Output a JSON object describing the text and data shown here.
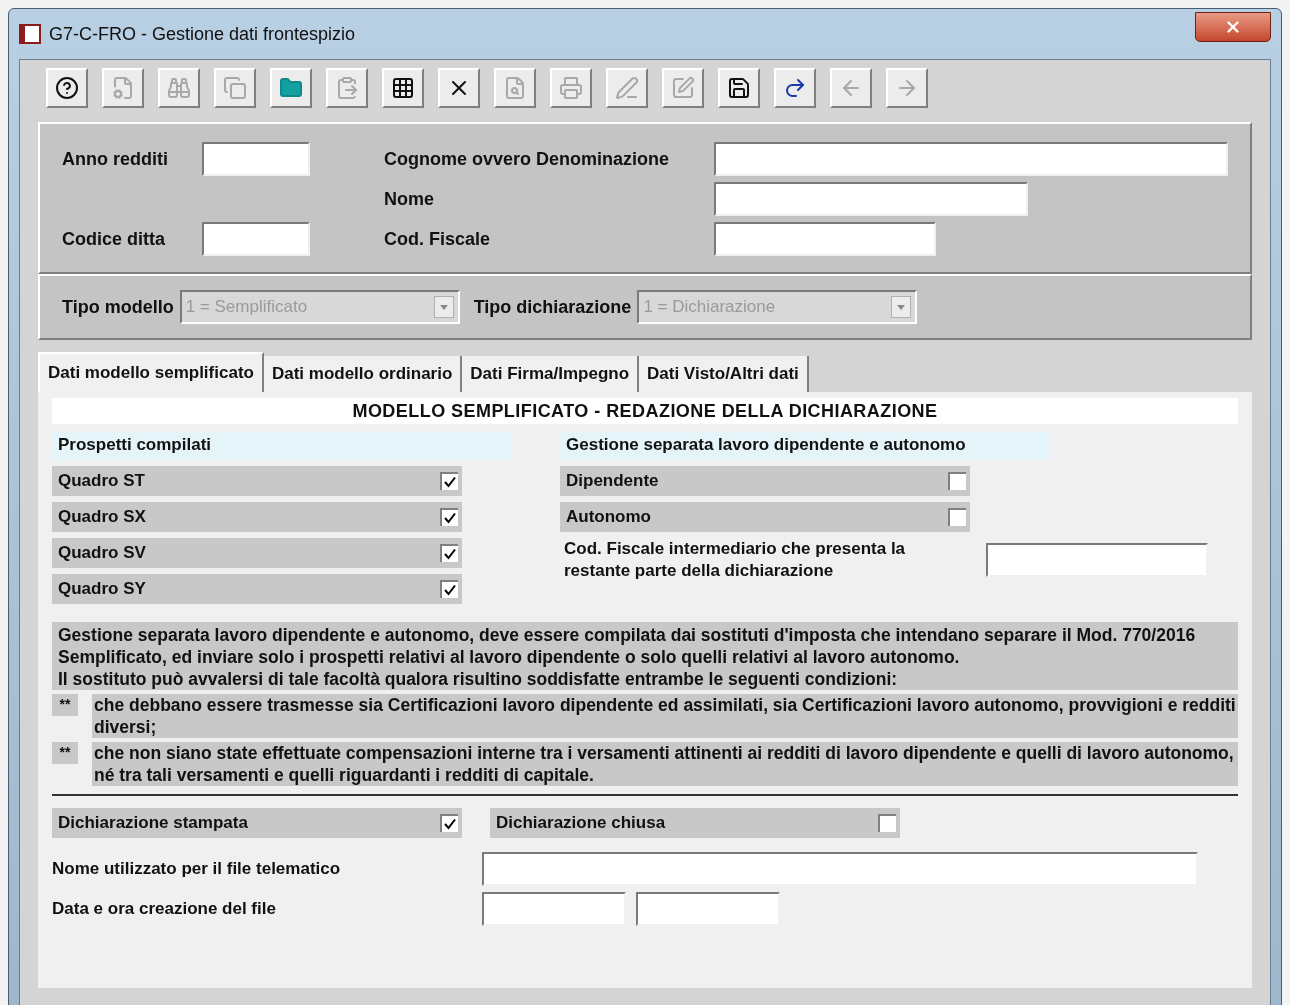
{
  "window": {
    "title": "G7-C-FRO - Gestione dati frontespizio"
  },
  "toolbar": [
    {
      "kind": "help",
      "disabled": false
    },
    {
      "kind": "properties",
      "disabled": true
    },
    {
      "kind": "search",
      "disabled": true
    },
    {
      "kind": "copy",
      "disabled": true
    },
    {
      "kind": "folder",
      "disabled": false
    },
    {
      "kind": "paste",
      "disabled": true
    },
    {
      "kind": "grid",
      "disabled": false
    },
    {
      "kind": "delete",
      "disabled": false
    },
    {
      "kind": "preview",
      "disabled": true
    },
    {
      "kind": "print",
      "disabled": true
    },
    {
      "kind": "edit",
      "disabled": true
    },
    {
      "kind": "form",
      "disabled": true
    },
    {
      "kind": "save",
      "disabled": false
    },
    {
      "kind": "redo",
      "disabled": false
    },
    {
      "kind": "back",
      "disabled": true
    },
    {
      "kind": "forward",
      "disabled": true
    }
  ],
  "header": {
    "anno_redditi": "Anno redditi",
    "codice_ditta": "Codice ditta",
    "cognome": "Cognome ovvero Denominazione",
    "nome": "Nome",
    "cod_fiscale": "Cod. Fiscale"
  },
  "selectors": [
    {
      "label": "Tipo modello",
      "value": "1 = Semplificato",
      "disabled": true
    },
    {
      "label": "Tipo dichiarazione",
      "value": "1 = Dichiarazione",
      "disabled": true
    }
  ],
  "tabs": [
    {
      "label": "Dati modello semplificato",
      "selected": true
    },
    {
      "label": "Dati modello ordinario",
      "selected": false
    },
    {
      "label": "Dati Firma/Impegno",
      "selected": false
    },
    {
      "label": "Dati Visto/Altri dati",
      "selected": false
    }
  ],
  "panel_title": "MODELLO SEMPLIFICATO - REDAZIONE DELLA DICHIARAZIONE",
  "prospetti": {
    "heading": "Prospetti compilati",
    "items": [
      {
        "label": "Quadro ST",
        "checked": true
      },
      {
        "label": "Quadro SX",
        "checked": true
      },
      {
        "label": "Quadro SV",
        "checked": true
      },
      {
        "label": "Quadro SY",
        "checked": true
      }
    ]
  },
  "gestione": {
    "heading": "Gestione separata lavoro dipendente e autonomo",
    "items": [
      {
        "label": "Dipendente",
        "checked": false
      },
      {
        "label": "Autonomo",
        "checked": false
      }
    ],
    "intermediary_label": "Cod. Fiscale intermediario che presenta la restante parte della dichiarazione"
  },
  "notes": {
    "paragraph": "Gestione separata lavoro dipendente e autonomo, deve essere compilata dai sostituti d'imposta che intendano separare il Mod. 770/2016 Semplificato, ed inviare solo i prospetti relativi al lavoro dipendente o solo quelli relativi al lavoro autonomo.",
    "condition": "Il sostituto può avvalersi di tale facoltà qualora risultino soddisfatte entrambe le seguenti condizioni:",
    "bullets": [
      {
        "marker": "**",
        "text": "che debbano essere trasmesse sia Certificazioni lavoro dipendente ed assimilati, sia Certificazioni lavoro autonomo, provvigioni e redditi diversi;"
      },
      {
        "marker": "**",
        "text": "che non siano state effettuate compensazioni interne tra i versamenti attinenti ai redditi di lavoro dipendente e quelli di lavoro autonomo, né tra tali versamenti e quelli riguardanti i redditi di capitale."
      }
    ]
  },
  "bottom": {
    "checks": [
      {
        "label": "Dichiarazione stampata",
        "checked": true
      },
      {
        "label": "Dichiarazione chiusa",
        "checked": false
      }
    ],
    "file_name_label": "Nome utilizzato per il file telematico",
    "file_date_label": "Data e ora creazione del file"
  }
}
